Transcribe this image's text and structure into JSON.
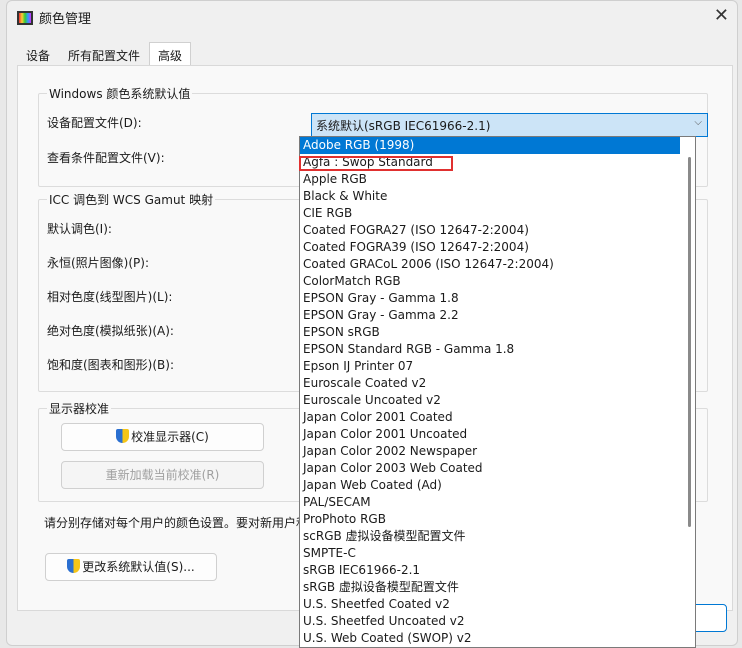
{
  "window": {
    "title": "颜色管理",
    "close": "✕"
  },
  "tabs": [
    "设备",
    "所有配置文件",
    "高级"
  ],
  "defaults": {
    "group": "Windows 颜色系统默认值",
    "device_profile_label": "设备配置文件(D):",
    "device_profile_value": "系统默认(sRGB IEC61966-2.1)",
    "viewing_label": "查看条件配置文件(V):"
  },
  "gamut": {
    "group": "ICC 调色到 WCS Gamut 映射",
    "labels": [
      "默认调色(I):",
      "永恒(照片图像)(P):",
      "相对色度(线型图片)(L):",
      "绝对色度(模拟纸张)(A):",
      "饱和度(图表和图形)(B):"
    ]
  },
  "calibration": {
    "group": "显示器校准",
    "calibrate": "校准显示器(C)",
    "reload": "重新加载当前校准(R)"
  },
  "note": "请分别存储对每个用户的颜色设置。要对新用户和",
  "change_defaults": "更改系统默认值(S)...",
  "dropdown": {
    "selected_index": 0,
    "highlighted_index": 1,
    "items": [
      "Adobe RGB (1998)",
      "Agfa : Swop Standard",
      "Apple RGB",
      "Black & White",
      "CIE RGB",
      "Coated FOGRA27 (ISO 12647-2:2004)",
      "Coated FOGRA39 (ISO 12647-2:2004)",
      "Coated GRACoL 2006 (ISO 12647-2:2004)",
      "ColorMatch RGB",
      "EPSON  Gray - Gamma 1.8",
      "EPSON  Gray - Gamma 2.2",
      "EPSON  sRGB",
      "EPSON  Standard RGB - Gamma 1.8",
      "Epson IJ Printer 07",
      "Euroscale Coated v2",
      "Euroscale Uncoated v2",
      "Japan Color 2001 Coated",
      "Japan Color 2001 Uncoated",
      "Japan Color 2002 Newspaper",
      "Japan Color 2003 Web Coated",
      "Japan Web Coated (Ad)",
      "PAL/SECAM",
      "ProPhoto RGB",
      "scRGB 虚拟设备模型配置文件",
      "SMPTE-C",
      "sRGB IEC61966-2.1",
      "sRGB 虚拟设备模型配置文件",
      "U.S. Sheetfed Coated v2",
      "U.S. Sheetfed Uncoated v2",
      "U.S. Web Coated (SWOP) v2"
    ]
  }
}
